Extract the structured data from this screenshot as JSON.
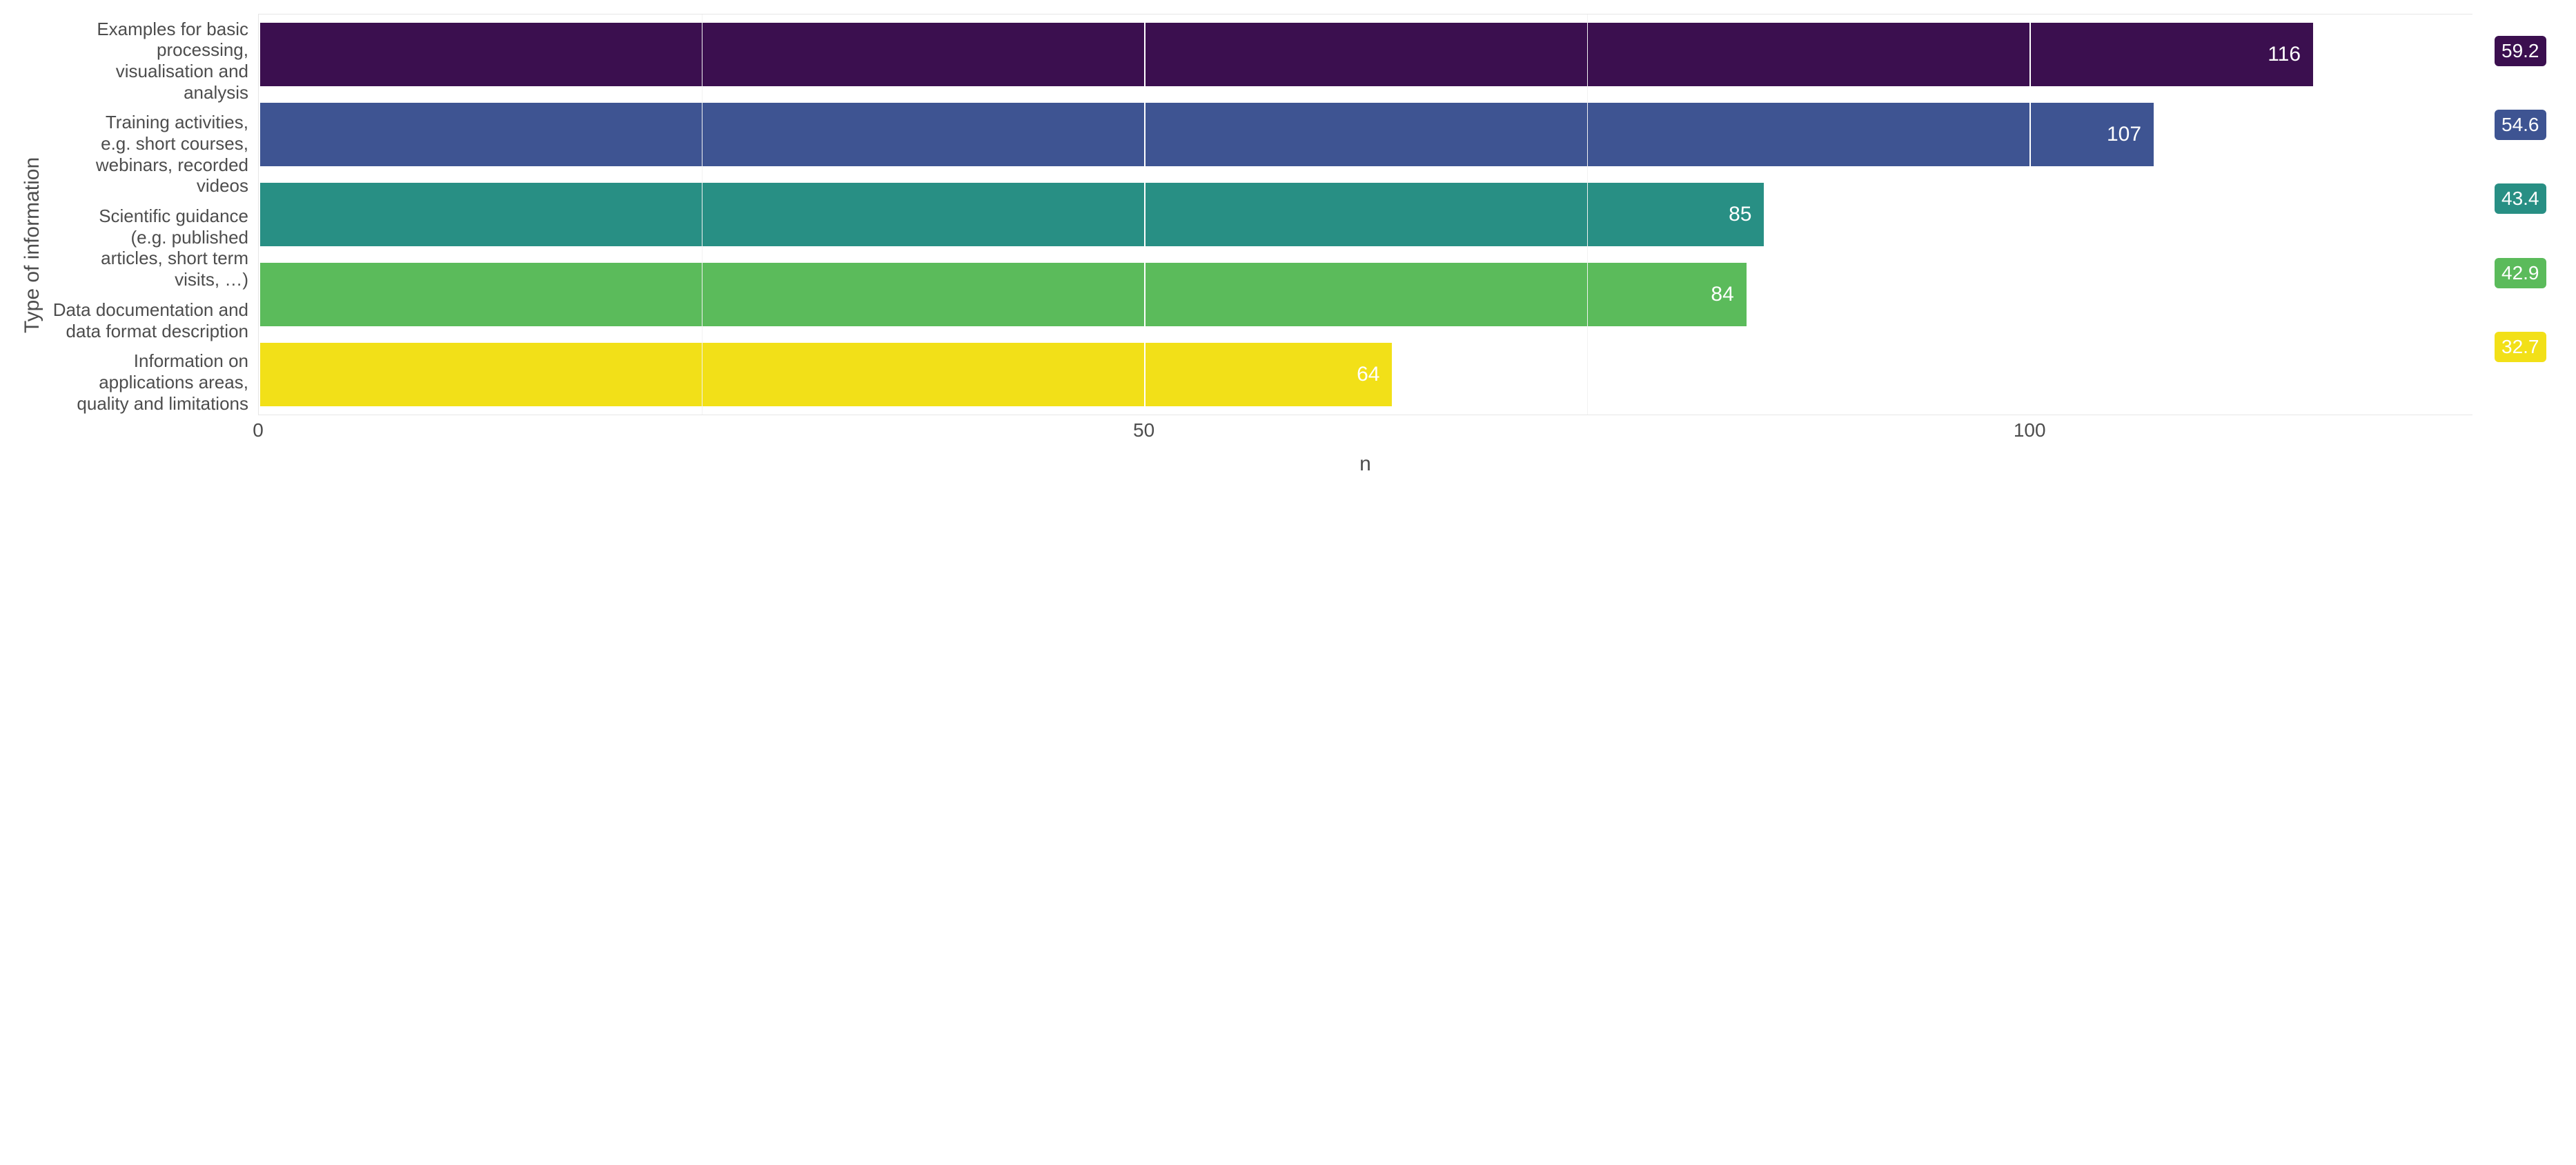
{
  "chart_data": {
    "type": "bar",
    "orientation": "horizontal",
    "xlabel": "n",
    "ylabel": "Type of information",
    "xlim": [
      0,
      125
    ],
    "x_ticks": [
      0,
      50,
      100
    ],
    "categories": [
      "Examples for basic\nprocessing,\nvisualisation and\nanalysis",
      "Training activities,\ne.g. short courses,\nwebinars, recorded\nvideos",
      "Scientific guidance\n(e.g. published\narticles, short term\nvisits, …)",
      "Data documentation and\ndata format description",
      "Information on\napplications areas,\nquality and limitations"
    ],
    "series": [
      {
        "name": "n",
        "values": [
          116,
          107,
          85,
          84,
          64
        ]
      },
      {
        "name": "pct",
        "values": [
          59.2,
          54.6,
          43.4,
          42.9,
          32.7
        ]
      }
    ],
    "colors": [
      "#3b0f4f",
      "#3e5492",
      "#288f84",
      "#5bbb5b",
      "#f2e018"
    ]
  },
  "labels": {
    "bar_value_text": [
      "116",
      "107",
      "85",
      "84",
      "64"
    ],
    "pct_text": [
      "59.2",
      "54.6",
      "43.4",
      "42.9",
      "32.7"
    ],
    "x_tick_text": [
      "0",
      "50",
      "100"
    ],
    "x_title": "n",
    "y_title": "Type of information"
  }
}
